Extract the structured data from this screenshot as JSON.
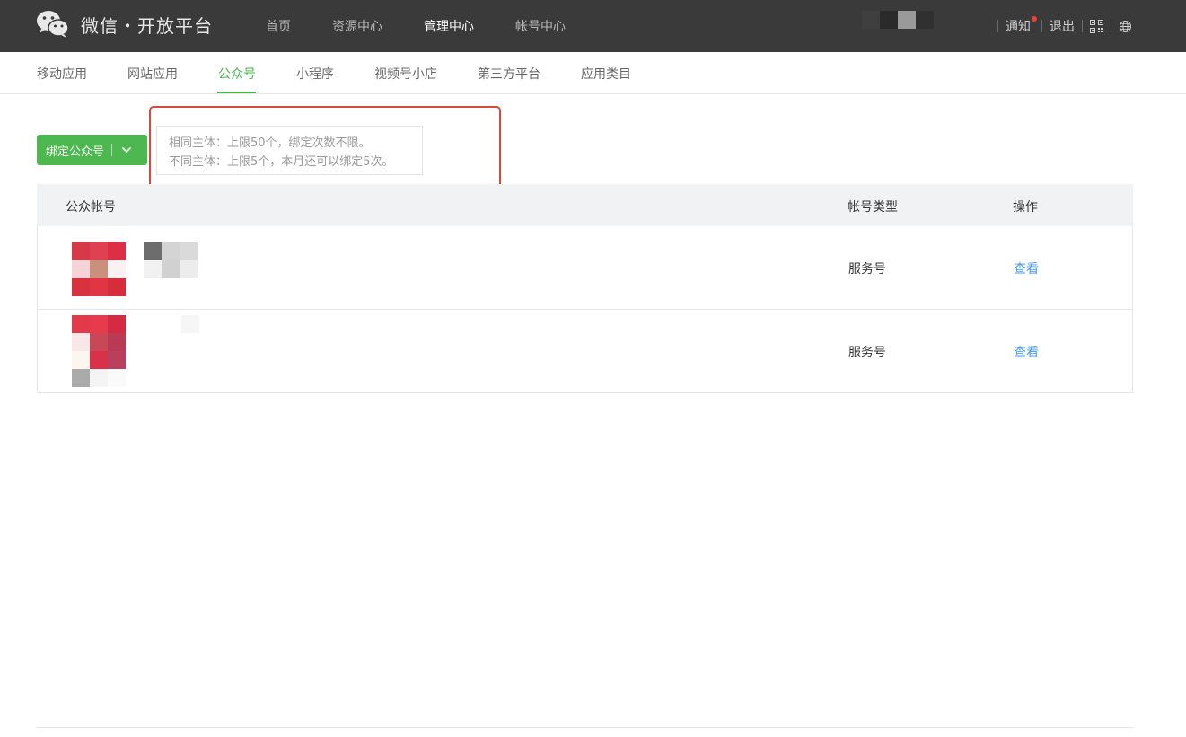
{
  "header": {
    "brand": "微信・开放平台",
    "nav": [
      "首页",
      "资源中心",
      "管理中心",
      "帐号中心"
    ],
    "nav_active_index": 2,
    "links": {
      "notice": "通知",
      "logout": "退出"
    }
  },
  "subnav": {
    "items": [
      "移动应用",
      "网站应用",
      "公众号",
      "小程序",
      "视频号小店",
      "第三方平台",
      "应用类目"
    ],
    "active_index": 2
  },
  "bind_button": {
    "label": "绑定公众号"
  },
  "tip": {
    "line1": "相同主体：上限50个，绑定次数不限。",
    "line2": "不同主体：上限5个，本月还可以绑定5次。"
  },
  "table": {
    "headers": {
      "account": "公众帐号",
      "type": "帐号类型",
      "action": "操作"
    },
    "rows": [
      {
        "type": "服务号",
        "action": "查看"
      },
      {
        "type": "服务号",
        "action": "查看"
      }
    ]
  },
  "colors": {
    "topbar_bg": "#3a3a3a",
    "accent_green": "#44b549",
    "link_blue": "#459ae9",
    "highlight_red": "#d64b3b"
  }
}
